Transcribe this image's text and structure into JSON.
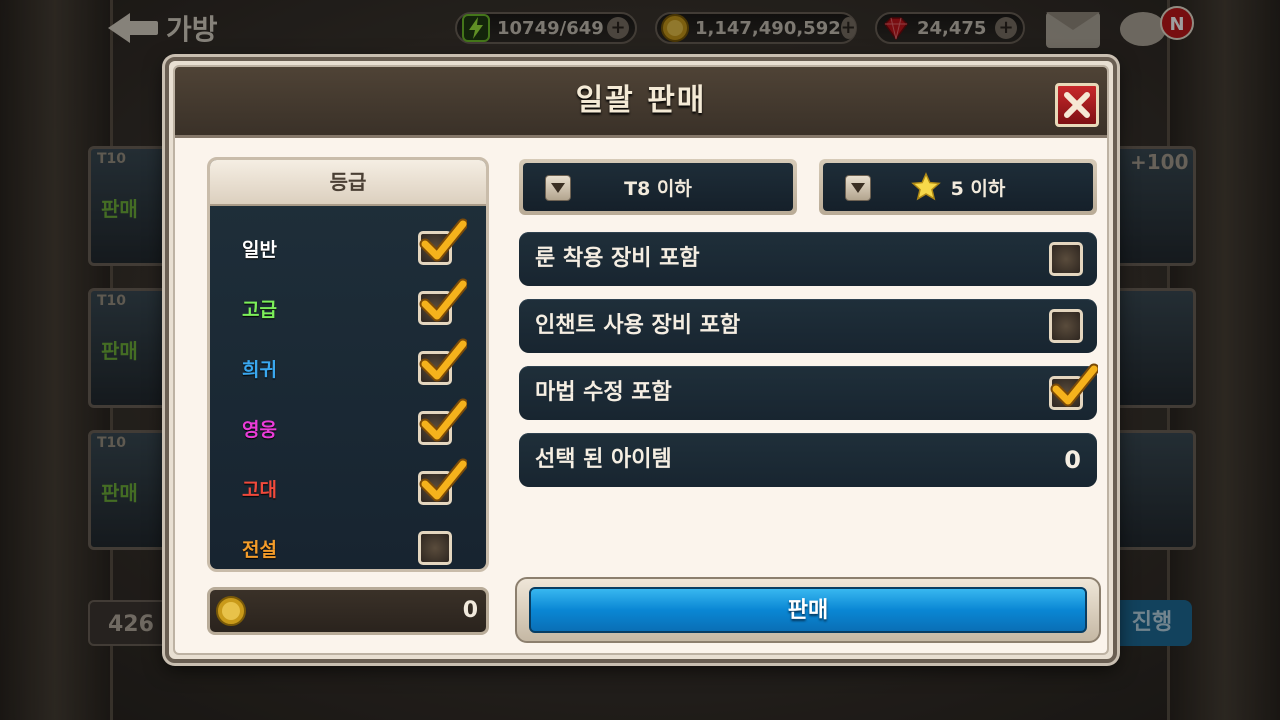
{
  "topbar": {
    "back_label": "가방",
    "energy": "10749/649",
    "gold": "1,147,490,592",
    "gems": "24,475",
    "notification_badge": "N"
  },
  "background": {
    "tier_label": "T10",
    "sell_state": "판매",
    "count": "426",
    "proceed_label": "진행",
    "plus_value": "+100"
  },
  "modal": {
    "title": "일괄 판매",
    "grade": {
      "header": "등급",
      "items": [
        {
          "label": "일반",
          "color": "#ffffff",
          "checked": true
        },
        {
          "label": "고급",
          "color": "#7cf05a",
          "checked": true
        },
        {
          "label": "희귀",
          "color": "#3aa8f0",
          "checked": true
        },
        {
          "label": "영웅",
          "color": "#ea3cd8",
          "checked": true
        },
        {
          "label": "고대",
          "color": "#f04a3c",
          "checked": true
        },
        {
          "label": "전설",
          "color": "#f39c2a",
          "checked": false
        }
      ]
    },
    "coin_total": "0",
    "filters": {
      "tier": "T8 이하",
      "star": "5 이하"
    },
    "options": [
      {
        "label": "룬 착용 장비 포함",
        "checked": false
      },
      {
        "label": "인챈트 사용 장비 포함",
        "checked": false
      },
      {
        "label": "마법 수정 포함",
        "checked": true
      }
    ],
    "selected": {
      "label": "선택 된 아이템",
      "value": "0"
    },
    "sell_label": "판매"
  }
}
